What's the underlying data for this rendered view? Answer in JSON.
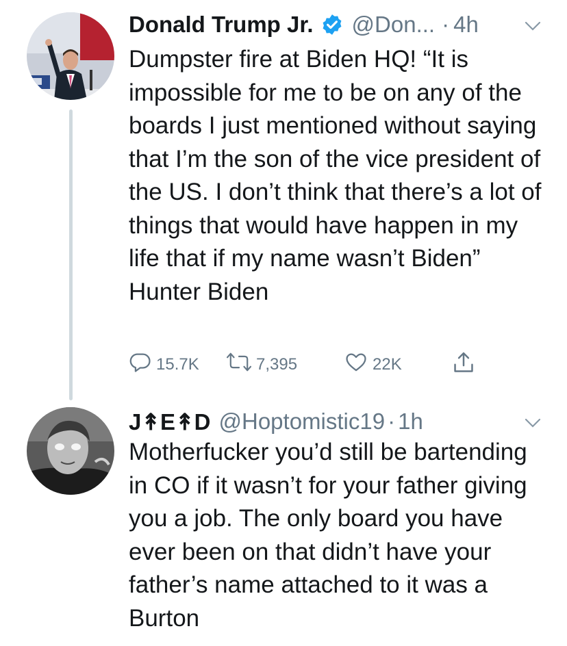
{
  "tweets": [
    {
      "author_name": "Donald Trump Jr.",
      "verified": true,
      "handle": "@Don...",
      "dot": "·",
      "time": "4h",
      "text": "Dumpster fire at Biden HQ! “It is impossible for me to be on any of the boards I just mentioned without saying that I’m the son of the vice president of the US. I don’t think that there’s a lot of things that would have happen in my life that if my name wasn’t Biden” Hunter Biden",
      "replies": "15.7K",
      "retweets": "7,395",
      "likes": "22K"
    },
    {
      "author_name": "J↟E↟D",
      "handle": "@Hoptomistic19",
      "dot": "·",
      "time": "1h",
      "text": "Motherfucker you’d still be bartending in CO if it wasn’t for your father giving you a job. The only board you have ever been on that didn’t have your father’s name attached to it was a Burton"
    }
  ],
  "colors": {
    "text": "#14171a",
    "secondary": "#657786",
    "verified": "#1da1f2",
    "thread_line": "#cfd9de"
  },
  "icons": [
    "reply-icon",
    "retweet-icon",
    "like-icon",
    "share-icon",
    "verified-icon",
    "chevron-down-icon"
  ]
}
